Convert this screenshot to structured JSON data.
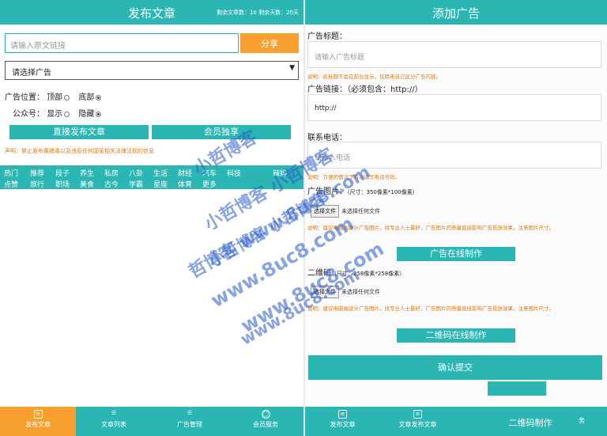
{
  "left": {
    "header": {
      "title": "发布文章",
      "stats": "剩余文章数：10 剩余天数：20天"
    },
    "url_input": {
      "placeholder": "请输入原文链接"
    },
    "share_label": "分享",
    "ad_select": {
      "selected": "请选择广告"
    },
    "ad_position": {
      "label": "广告位置：",
      "options": [
        "顶部",
        "底部"
      ],
      "selected": "底部"
    },
    "wechat": {
      "label": "公众号：",
      "options": [
        "显示",
        "隐藏"
      ],
      "selected": "隐藏"
    },
    "publish_direct_label": "直接发布文章",
    "member_label": "会员独享",
    "notice": "声明：禁止发布黄赌毒以及违反任何国家相关法律法规的信息",
    "categories_row1": [
      "热门",
      "推荐",
      "段子",
      "养生",
      "私房",
      "八卦",
      "生活",
      "财经",
      "汽车",
      "科技",
      "辣妈"
    ],
    "categories_row2": [
      "点赞",
      "旅行",
      "职场",
      "美食",
      "古今",
      "学霸",
      "星座",
      "体育",
      "更多"
    ],
    "tabs": [
      {
        "label": "发布文章",
        "icon": "document-icon",
        "active": true
      },
      {
        "label": "文章列表",
        "icon": "list-icon",
        "active": false
      },
      {
        "label": "广告管理",
        "icon": "list-icon",
        "active": false
      },
      {
        "label": "会员服务",
        "icon": "user-icon",
        "active": false
      }
    ]
  },
  "right": {
    "header": {
      "title": "添加广告"
    },
    "ad_title": {
      "label": "广告标题：",
      "placeholder": "请输入广告标题",
      "hint": "说明：此标题不会在前台显示，仅用来自己区分广告内容。"
    },
    "ad_link": {
      "label": "广告链接：（必须包含：http://）",
      "value": "http://"
    },
    "contact": {
      "label": "联系电话：",
      "placeholder": "请输入电话",
      "hint": "说明：方便的情况下可以填写电话号码。"
    },
    "ad_image": {
      "label": "广告图片：",
      "size_note": "（尺寸：350像素*100像素）",
      "button": "选择文件",
      "status": "未选择任何文件",
      "hint": "说明：建议电脑端设计广告图片，找专业人士最好，广告图片的质量直接影响广告投放效果，注意图片尺寸。"
    },
    "ad_online_label": "广告在线制作",
    "qrcode": {
      "label": "二维码",
      "size_note": "（尺寸：258像素*258像素）",
      "button": "选择文件",
      "status": "未选择任何文件",
      "hint": "说明：建议电脑端设计广告图片，找专业人士最好，广告图片的质量直接影响广告投放效果，注意图片尺寸。"
    },
    "qr_online_label": "二维码在线制作",
    "submit_label": "确认提交",
    "tabs": [
      {
        "label": "发布文章",
        "icon": "document-icon"
      },
      {
        "label": "文章发布文章",
        "icon": "document-icon"
      },
      {
        "label": "二维码制作",
        "icon": "list-icon"
      },
      {
        "label": "务",
        "icon": "user-icon"
      }
    ]
  },
  "watermarks": [
    "小哲博客",
    "小哲博客 小哲博客",
    "小哲博客 小哲博客",
    "哲博客 www.8uc8.com",
    "www.8uc8.com",
    "www.8uc8.com",
    "www.8uc8.com"
  ],
  "colors": {
    "teal": "#2bb5b3",
    "orange": "#f7a02f",
    "hint": "#e07b12",
    "watermark": "#285ac8"
  }
}
